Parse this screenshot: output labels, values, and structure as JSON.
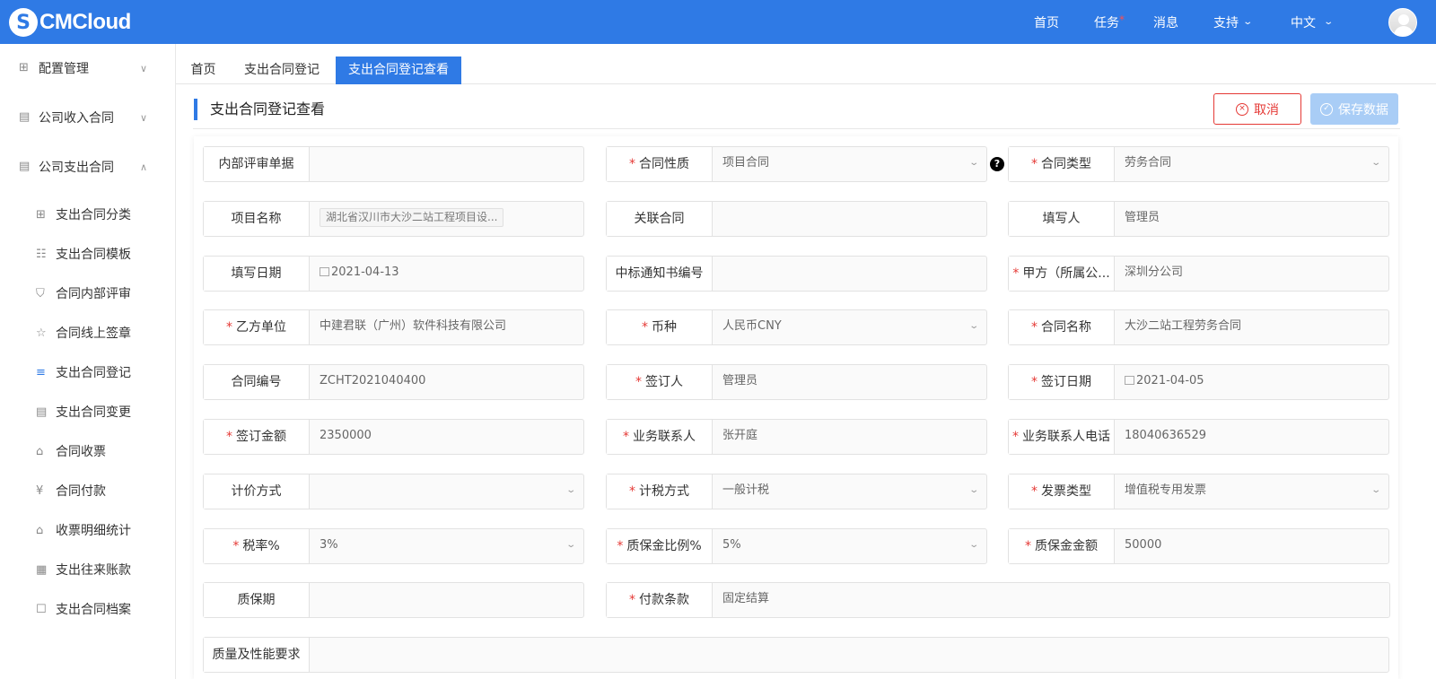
{
  "header": {
    "logo_mark": "S",
    "logo_text": "CMCloud",
    "nav": {
      "home": "首页",
      "tasks": "任务",
      "tasks_badge": "*",
      "messages": "消息",
      "support": "支持",
      "language": "中文"
    }
  },
  "sidebar": {
    "groups": [
      {
        "label": "配置管理",
        "icon": "grid-icon",
        "state": "collapsed"
      },
      {
        "label": "公司收入合同",
        "icon": "contract-in-icon",
        "state": "collapsed"
      },
      {
        "label": "公司支出合同",
        "icon": "contract-out-icon",
        "state": "expanded"
      }
    ],
    "items": [
      {
        "label": "支出合同分类",
        "icon": "grid-icon"
      },
      {
        "label": "支出合同模板",
        "icon": "sitemap-icon"
      },
      {
        "label": "合同内部评审",
        "icon": "shield-icon"
      },
      {
        "label": "合同线上签章",
        "icon": "star-doc-icon"
      },
      {
        "label": "支出合同登记",
        "icon": "database-icon",
        "active": true
      },
      {
        "label": "支出合同变更",
        "icon": "doc-edit-icon"
      },
      {
        "label": "合同收票",
        "icon": "house-icon"
      },
      {
        "label": "合同付款",
        "icon": "yen-icon"
      },
      {
        "label": "收票明细统计",
        "icon": "house-list-icon"
      },
      {
        "label": "支出往来账款",
        "icon": "calendar-icon"
      },
      {
        "label": "支出合同档案",
        "icon": "clipboard-icon"
      }
    ]
  },
  "tabs": [
    {
      "label": "首页"
    },
    {
      "label": "支出合同登记"
    },
    {
      "label": "支出合同登记查看",
      "active": true
    }
  ],
  "page": {
    "title": "支出合同登记查看",
    "cancel_label": "取消",
    "save_label": "保存数据"
  },
  "form": {
    "fields": [
      {
        "label": "内部评审单据",
        "required": false,
        "value": ""
      },
      {
        "label": "合同性质",
        "required": true,
        "value": "项目合同",
        "select": true
      },
      {
        "label": "合同类型",
        "required": true,
        "value": "劳务合同",
        "select": true
      },
      {
        "label": "项目名称",
        "required": false,
        "value": "湖北省汉川市大沙二站工程项目设...",
        "tag": true
      },
      {
        "label": "关联合同",
        "required": false,
        "value": ""
      },
      {
        "label": "填写人",
        "required": false,
        "value": "管理员"
      },
      {
        "label": "填写日期",
        "required": false,
        "value": "2021-04-13",
        "date": true
      },
      {
        "label": "中标通知书编号",
        "required": false,
        "value": ""
      },
      {
        "label": "甲方（所属公...",
        "required": true,
        "value": "深圳分公司"
      },
      {
        "label": "乙方单位",
        "required": true,
        "value": "中建君联（广州）软件科技有限公司"
      },
      {
        "label": "币种",
        "required": true,
        "value": "人民币CNY",
        "select": true
      },
      {
        "label": "合同名称",
        "required": true,
        "value": "大沙二站工程劳务合同"
      },
      {
        "label": "合同编号",
        "required": false,
        "value": "ZCHT2021040400"
      },
      {
        "label": "签订人",
        "required": true,
        "value": "管理员"
      },
      {
        "label": "签订日期",
        "required": true,
        "value": "2021-04-05",
        "date": true
      },
      {
        "label": "签订金额",
        "required": true,
        "value": "2350000"
      },
      {
        "label": "业务联系人",
        "required": true,
        "value": "张开庭"
      },
      {
        "label": "业务联系人电话",
        "required": true,
        "value": "18040636529"
      },
      {
        "label": "计价方式",
        "required": false,
        "value": "",
        "select": true
      },
      {
        "label": "计税方式",
        "required": true,
        "value": "一般计税",
        "select": true
      },
      {
        "label": "发票类型",
        "required": true,
        "value": "增值税专用发票",
        "select": true
      },
      {
        "label": "税率%",
        "required": true,
        "value": "3%",
        "select": true
      },
      {
        "label": "质保金比例%",
        "required": true,
        "value": "5%",
        "select": true
      },
      {
        "label": "质保金金额",
        "required": true,
        "value": "50000"
      },
      {
        "label": "质保期",
        "required": false,
        "value": ""
      },
      {
        "label": "付款条款",
        "required": true,
        "value": "固定结算"
      },
      {
        "label": "质量及性能要求",
        "required": false,
        "value": ""
      }
    ],
    "help_mark": "?"
  }
}
